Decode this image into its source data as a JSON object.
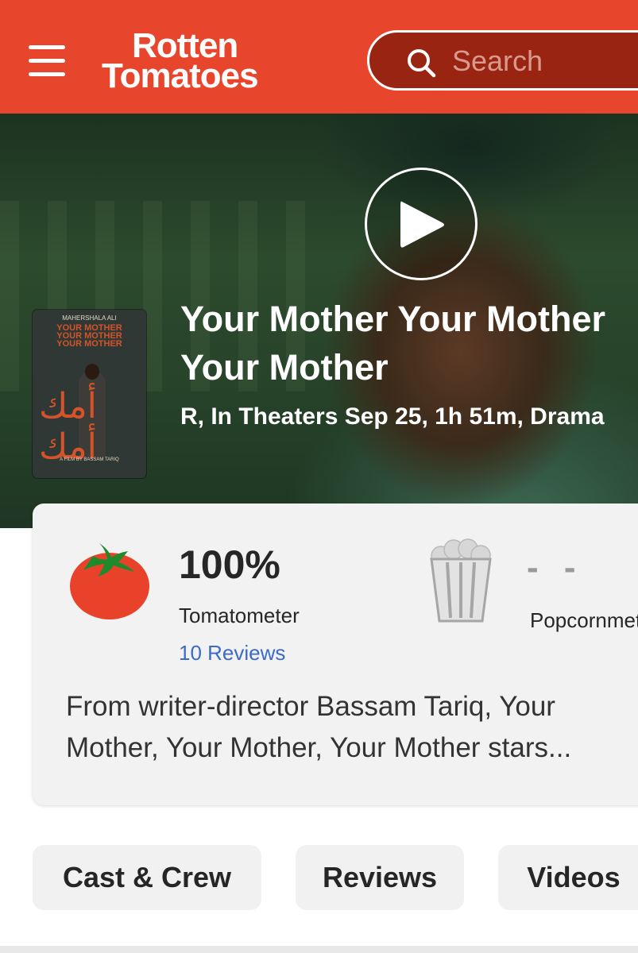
{
  "header": {
    "logo_line1": "Rotten",
    "logo_line2": "Tomatoes",
    "search_placeholder": "Search",
    "bg_color": "#e8462c"
  },
  "hero": {
    "title": "Your Mother Your Mother Your Mother",
    "meta": "R, In Theaters Sep 25, 1h 51m,  Drama"
  },
  "poster": {
    "top_text": "MAHERSHALA ALI",
    "title_lines": [
      "YOUR MOTHER",
      "YOUR MOTHER",
      "YOUR MOTHER"
    ],
    "arabic": "أمك أمك",
    "bottom_text": "A FILM BY BASSAM TARIQ"
  },
  "scores": {
    "tomatometer_value": "100%",
    "tomatometer_label": "Tomatometer",
    "reviews_link": "10 Reviews",
    "popcorn_value": "- -",
    "popcorn_label": "Popcornmeter",
    "synopsis": "From writer-director Bassam Tariq, Your Mother, Your Mother, Your Mother stars..."
  },
  "nav": {
    "cast": "Cast & Crew",
    "reviews": "Reviews",
    "videos": "Videos"
  },
  "icons": {
    "menu": "hamburger-menu-icon",
    "search": "search-icon",
    "play": "play-icon",
    "tomato": "tomato-icon",
    "popcorn": "popcorn-bucket-icon"
  }
}
